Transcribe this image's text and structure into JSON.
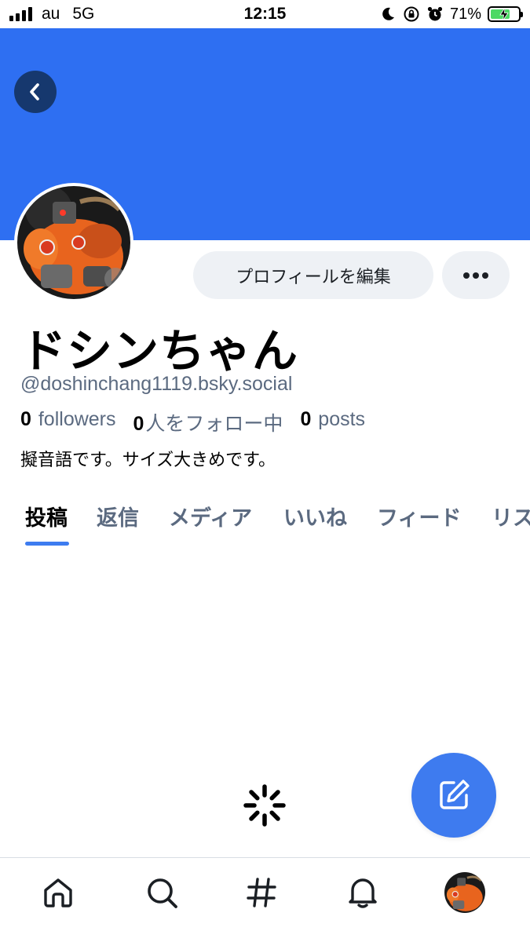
{
  "status_bar": {
    "carrier": "au",
    "network": "5G",
    "time": "12:15",
    "battery_percent": "71%",
    "battery_level": 0.71,
    "icons": [
      "signal-icon",
      "moon-icon",
      "rotation-lock-icon",
      "alarm-icon",
      "battery-charging-icon"
    ]
  },
  "colors": {
    "banner": "#2e6ff2",
    "accent": "#3e7bef",
    "muted_text": "#5b6a80"
  },
  "header": {
    "back_icon": "chevron-left-icon"
  },
  "profile": {
    "display_name": "ドシンちゃん",
    "handle": "@doshinchang1119.bsky.social",
    "followers_count": "0",
    "followers_label": "followers",
    "following_count": "0",
    "following_label": "人をフォロー中",
    "posts_count": "0",
    "posts_label": "posts",
    "bio": "擬音語です。サイズ大きめです。",
    "edit_button": "プロフィールを編集",
    "more_icon": "ellipsis-icon"
  },
  "tabs": [
    {
      "label": "投稿",
      "active": true
    },
    {
      "label": "返信",
      "active": false
    },
    {
      "label": "メディア",
      "active": false
    },
    {
      "label": "いいね",
      "active": false
    },
    {
      "label": "フィード",
      "active": false
    },
    {
      "label": "リスト",
      "active": false
    }
  ],
  "fab": {
    "icon": "compose-icon"
  },
  "bottom_nav": [
    {
      "icon": "home-icon"
    },
    {
      "icon": "search-icon"
    },
    {
      "icon": "hashtag-icon"
    },
    {
      "icon": "bell-icon"
    },
    {
      "icon": "profile-avatar"
    }
  ]
}
